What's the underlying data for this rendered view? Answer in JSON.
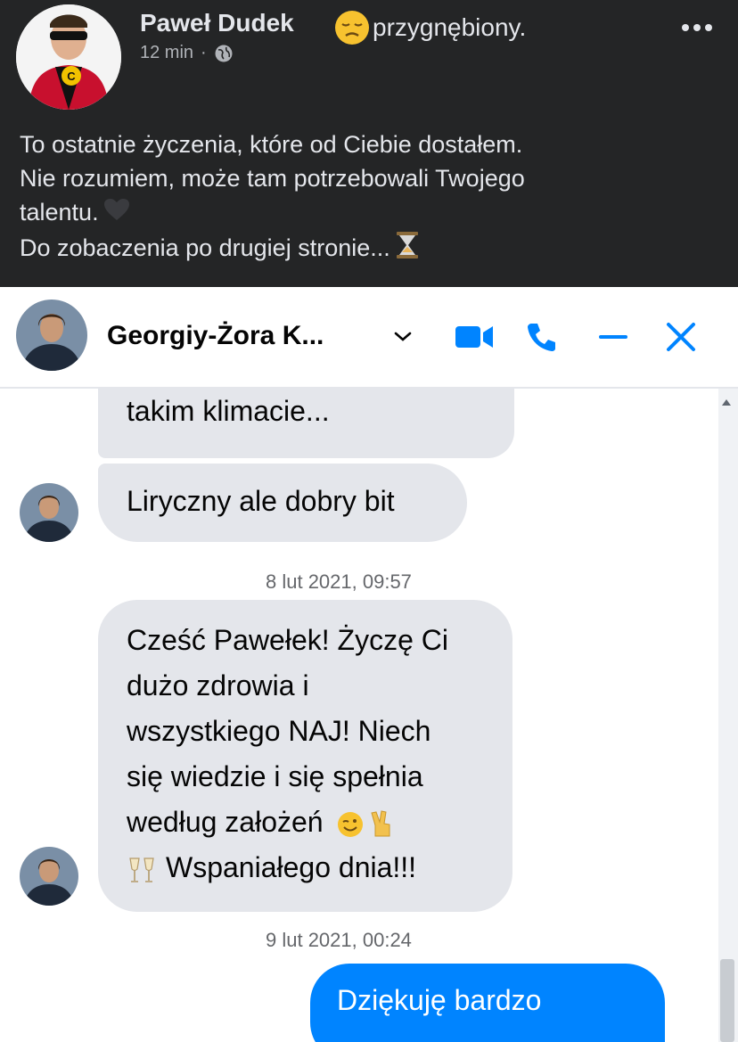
{
  "post": {
    "author": "Paweł Dudek",
    "feeling": "przygnębiony.",
    "time": "12 min",
    "separator": "·",
    "lines": [
      "To ostatnie życzenia, które od Ciebie dostałem.",
      "Nie rozumiem, może tam potrzebowali Twojego",
      "talentu.",
      "Do zobaczenia po drugiej stronie..."
    ],
    "icons": [
      "sad-emoji-icon",
      "globe-icon",
      "more-options-icon",
      "black-heart-icon",
      "hourglass-icon"
    ]
  },
  "chat": {
    "contact_name": "Georgiy-Żora K...",
    "icons": [
      "chevron-down-icon",
      "video-call-icon",
      "phone-call-icon",
      "minimize-icon",
      "close-icon"
    ],
    "accent_color": "#0084ff",
    "messages": {
      "m1_text": "takim klimacie...",
      "m2_text": "Liryczny ale dobry bit",
      "ts1": "8 lut 2021, 09:57",
      "m3_lines": [
        "Cześć Pawełek! Życzę Ci",
        "dużo zdrowia i",
        "wszystkiego NAJ! Niech",
        "się wiedzie i się spełnia",
        "według założeń",
        "Wspaniałego dnia!!!"
      ],
      "ts2": "9 lut 2021, 00:24",
      "sent_text": "Dziękuję bardzo"
    }
  }
}
